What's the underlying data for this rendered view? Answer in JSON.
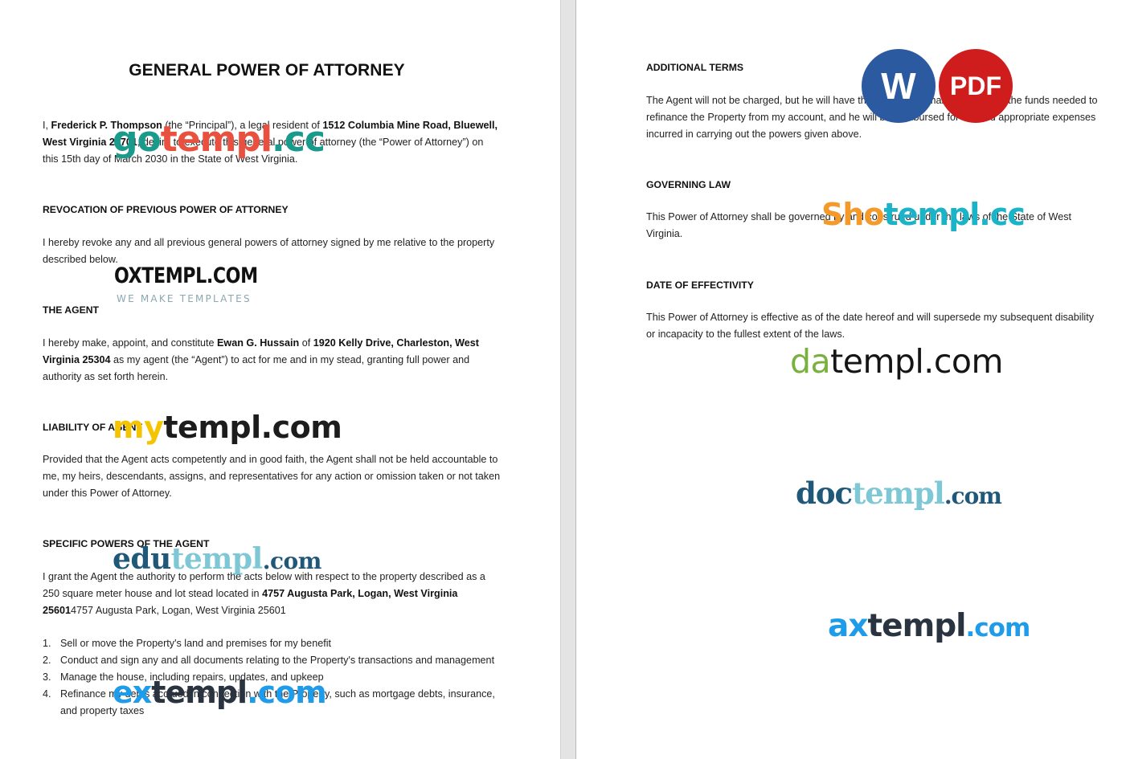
{
  "left_page": {
    "title": "GENERAL POWER OF ATTORNEY",
    "intro": {
      "p1": "I, ",
      "principal_name": "Frederick P. Thompson",
      "p2": " (the “Principal”), a legal resident of ",
      "principal_address": "1512 Columbia Mine Road, Bluewell, West Virginia 24701",
      "p3": ", desire to execute this general power of attorney (the “Power of Attorney”) on this 15th day of March 2030 in the State of West Virginia."
    },
    "revocation": {
      "heading": "REVOCATION OF PREVIOUS POWER OF ATTORNEY",
      "body": "I hereby revoke any and all previous general powers of attorney signed by me relative to the property described below."
    },
    "agent": {
      "heading": "THE AGENT",
      "p1": "I hereby make, appoint, and constitute ",
      "agent_name": "Ewan G. Hussain",
      "p2": " of ",
      "agent_address": "1920 Kelly Drive, Charleston, West Virginia 25304",
      "p3": " as my agent (the “Agent”) to act for me and in my stead, granting full power and authority as set forth herein."
    },
    "liability": {
      "heading": "LIABILITY OF AGENT",
      "body": "Provided that the Agent acts competently and in good faith, the Agent shall not be held accountable to me, my heirs, descendants, assigns, and representatives for any action or omission taken or not taken under this Power of Attorney."
    },
    "specific_powers": {
      "heading": "SPECIFIC POWERS OF THE AGENT",
      "p1": "I grant the Agent the authority to perform the acts below with respect to the property described as a 250 square meter house and lot stead located in ",
      "property_address": "4757 Augusta Park, Logan, West Virginia 25601",
      "p2": "4757 Augusta Park, Logan, West Virginia 25601",
      "items": [
        {
          "num": "1.",
          "text": "Sell or move the Property's land and premises for my benefit"
        },
        {
          "num": "2.",
          "text": "Conduct and sign any and all documents relating to the Property's transactions and management"
        },
        {
          "num": "3.",
          "text": "Manage the house, including repairs, updates, and upkeep"
        },
        {
          "num": "4.",
          "text": "Refinance my debts accrued in connection with the Property, such as mortgage debts, insurance, and property taxes"
        }
      ]
    }
  },
  "right_page": {
    "additional_terms": {
      "heading": "ADDITIONAL TERMS",
      "body": "The Agent will not be charged, but he will have the authority to make or disburse the funds needed to refinance the Property from my account, and he will be reimbursed for fair and appropriate expenses incurred in carrying out the powers given above."
    },
    "governing_law": {
      "heading": "GOVERNING LAW",
      "body": "This Power of Attorney shall be governed by and construed under the laws of the State of West Virginia."
    },
    "effectivity": {
      "heading": "DATE OF EFFECTIVITY",
      "body": "This Power of Attorney is effective as of the date hereof and will supersede my subsequent disability or incapacity to the fullest extent of the laws."
    }
  },
  "badges": {
    "word": {
      "label": "W",
      "color": "#2c5aa0"
    },
    "pdf": {
      "label": "PDF",
      "color": "#cf1d1d"
    }
  },
  "watermarks": {
    "gotempl": [
      "go",
      "templ",
      ".cc"
    ],
    "oxtempl": {
      "name": "OXTEMPL.COM",
      "tagline": "WE MAKE TEMPLATES"
    },
    "mytempl": [
      "my",
      "templ.com"
    ],
    "edutempl": [
      "edu",
      "templ",
      ".com"
    ],
    "extempl": [
      "ex",
      "templ",
      ".com"
    ],
    "shotempl": [
      "Sho",
      "templ.cc"
    ],
    "datempl": [
      "da",
      "templ.com"
    ],
    "doctempl": [
      "doc",
      "templ",
      ".com"
    ],
    "axtempl": [
      "ax",
      "templ",
      ".com"
    ]
  }
}
